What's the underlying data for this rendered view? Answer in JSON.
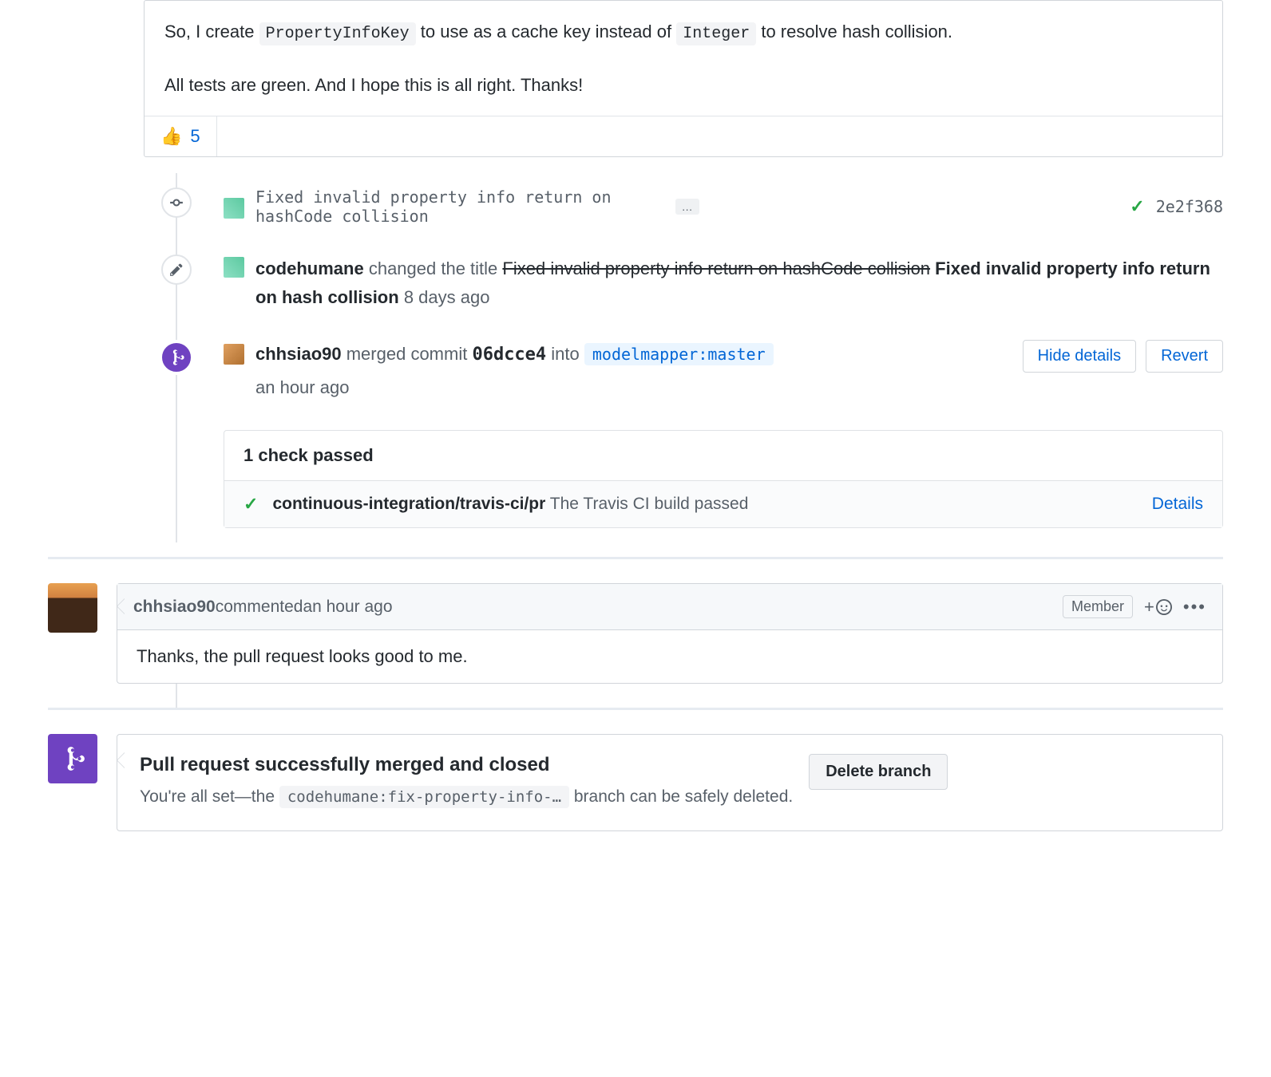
{
  "top_comment": {
    "line1_pre": "So, I create ",
    "line1_code": "PropertyInfoKey",
    "line1_mid": " to use as a cache key instead of ",
    "line1_code2": "Integer",
    "line1_post": " to resolve hash collision.",
    "line2": "All tests are green. And I hope this is all right. Thanks!",
    "reaction_emoji": "👍",
    "reaction_count": "5"
  },
  "commit": {
    "message": "Fixed invalid property info return on hashCode collision",
    "ellipsis": "…",
    "status": "✓",
    "sha": "2e2f368"
  },
  "title_change": {
    "user": "codehumane",
    "action": " changed the title ",
    "old_title": "Fixed invalid property info return on hashCode collision",
    "new_title": " Fixed invalid property info return on hash collision",
    "time": " 8 days ago"
  },
  "merge_event": {
    "user": "chhsiao90",
    "action": " merged commit ",
    "sha": "06dcce4",
    "into": " into ",
    "branch": "modelmapper:master",
    "time": "an hour ago",
    "hide_details": "Hide details",
    "revert": "Revert"
  },
  "checks": {
    "header": "1 check passed",
    "check_icon": "✓",
    "name": "continuous-integration/travis-ci/pr",
    "desc": " The Travis CI build passed",
    "details": "Details"
  },
  "comment2": {
    "user": "chhsiao90",
    "action": " commented ",
    "time": "an hour ago",
    "badge": "Member",
    "plus": "+",
    "body": "Thanks, the pull request looks good to me."
  },
  "merge_final": {
    "title": "Pull request successfully merged and closed",
    "pre": "You're all set—the ",
    "branch": "codehumane:fix-property-info-…",
    "post": " branch can be safely deleted.",
    "btn": "Delete branch"
  }
}
